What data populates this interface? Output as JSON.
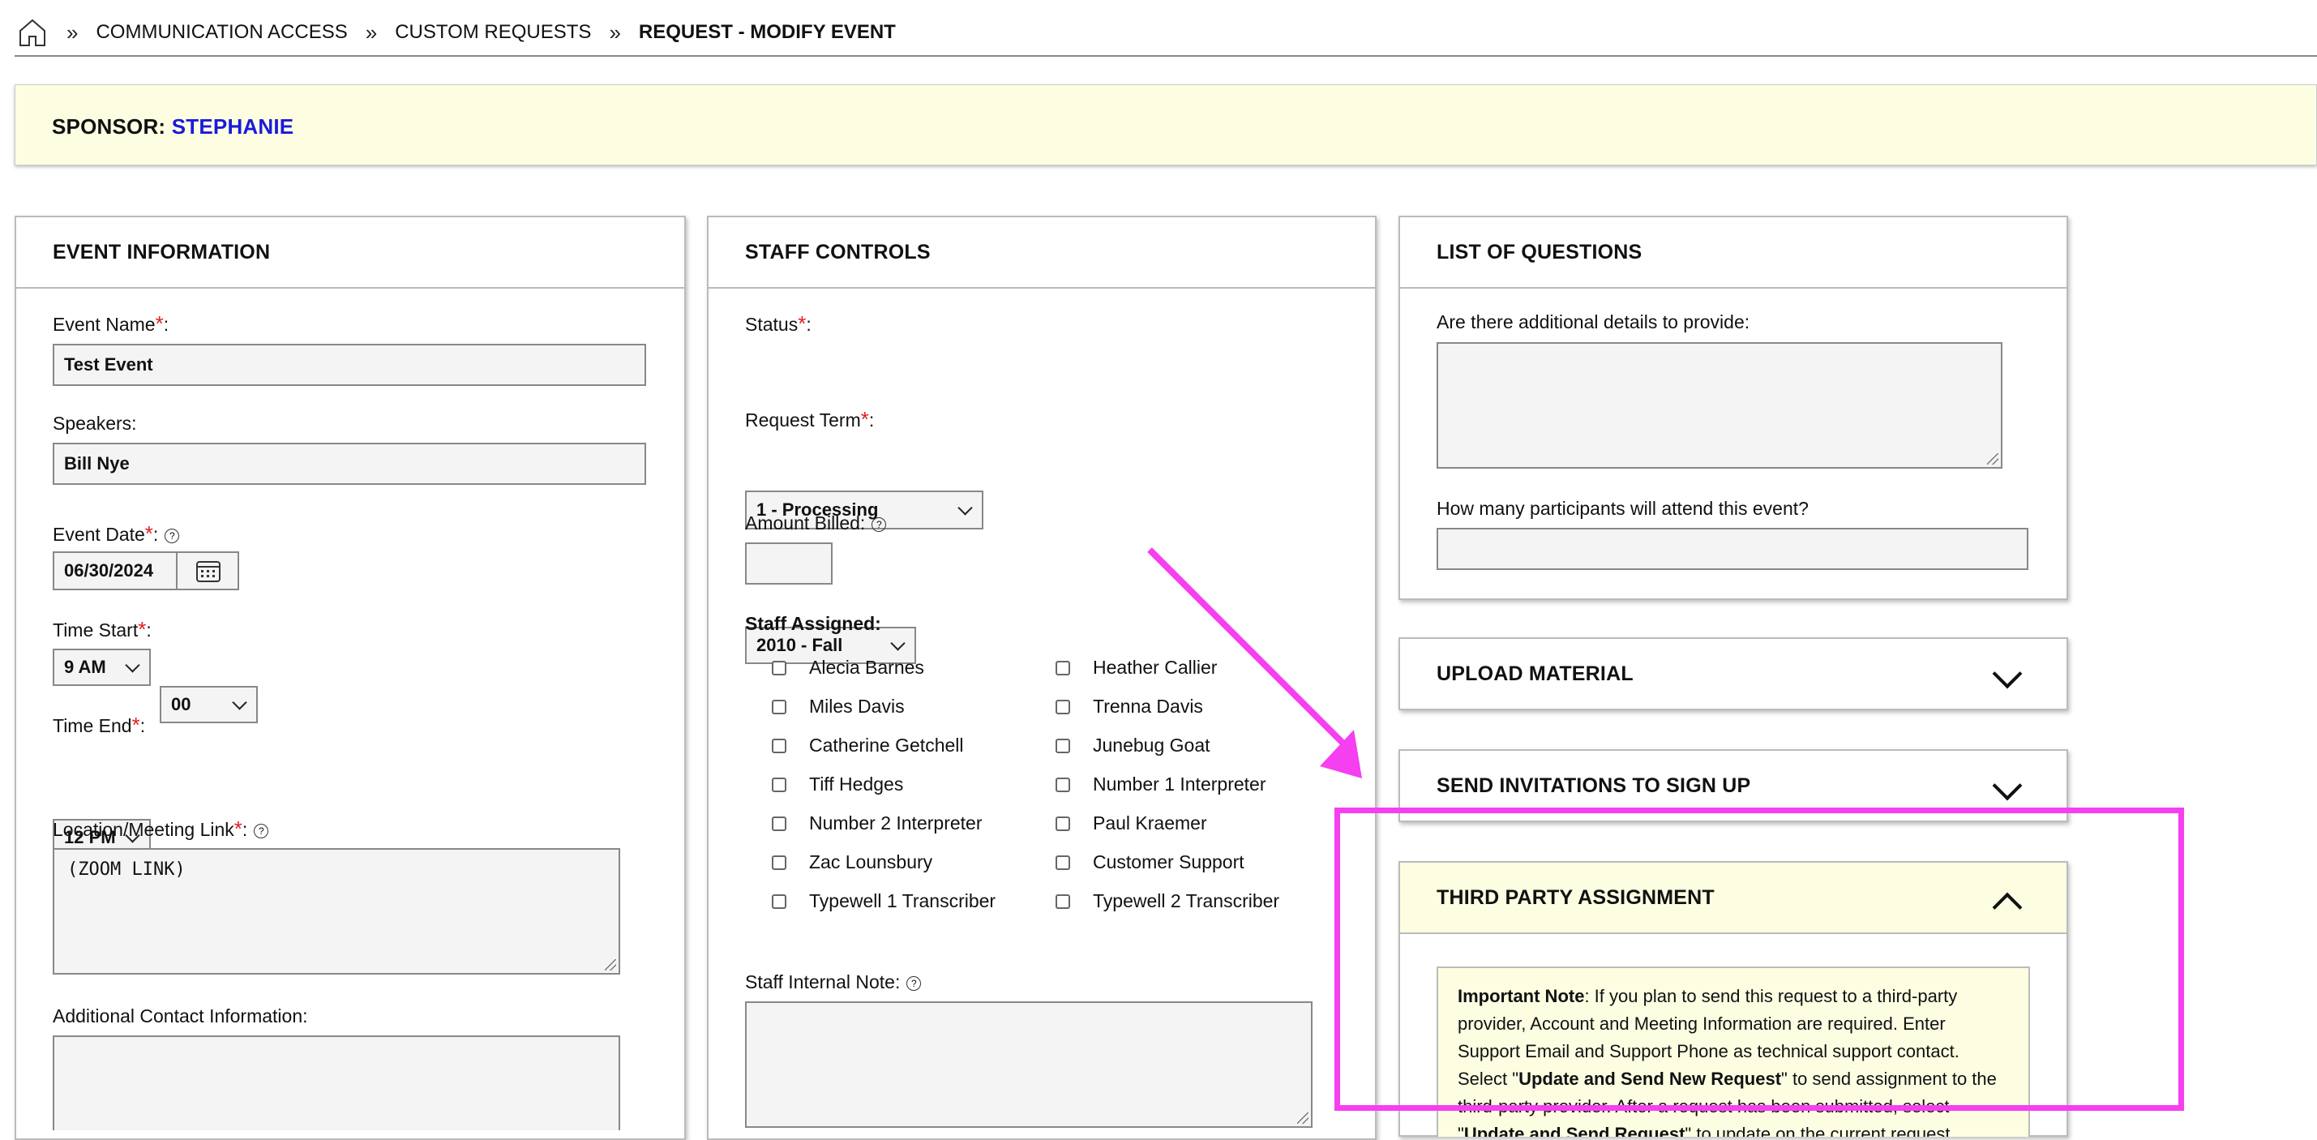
{
  "breadcrumb": {
    "items": [
      "COMMUNICATION ACCESS",
      "CUSTOM REQUESTS"
    ],
    "current": "REQUEST - MODIFY EVENT",
    "separator": "»"
  },
  "sponsor": {
    "label": "SPONSOR:",
    "name": "STEPHANIE"
  },
  "event_info": {
    "title": "EVENT INFORMATION",
    "event_name_label": "Event Name",
    "event_name_value": "Test Event",
    "speakers_label": "Speakers:",
    "speakers_value": "Bill Nye",
    "event_date_label": "Event Date",
    "event_date_value": "06/30/2024",
    "time_start_label": "Time Start",
    "time_start_hour": "9 AM",
    "time_start_min": "00",
    "time_end_label": "Time End",
    "time_end_hour": "12 PM",
    "time_end_min": "00",
    "location_label": "Location/Meeting Link",
    "location_value": "(ZOOM LINK)",
    "additional_contact_label": "Additional Contact Information:"
  },
  "staff_controls": {
    "title": "STAFF CONTROLS",
    "status_label": "Status",
    "status_value": "1 - Processing",
    "term_label": "Request Term",
    "term_value": "2010 - Fall",
    "amount_label": "Amount Billed:",
    "staff_assigned_label": "Staff Assigned:",
    "staff_col1": [
      "Alecia Barnes",
      "Miles Davis",
      "Catherine Getchell",
      "Tiff Hedges",
      "Number 2 Interpreter",
      "Zac Lounsbury",
      "Typewell 1 Transcriber"
    ],
    "staff_col2": [
      "Heather Callier",
      "Trenna Davis",
      "Junebug Goat",
      "Number 1 Interpreter",
      "Paul Kraemer",
      "Customer Support",
      "Typewell 2 Transcriber"
    ],
    "internal_note_label": "Staff Internal Note:"
  },
  "questions": {
    "title": "LIST OF QUESTIONS",
    "q1": "Are there additional details to provide:",
    "q2": "How many participants will attend this event?"
  },
  "upload": {
    "title": "UPLOAD MATERIAL"
  },
  "invitations": {
    "title": "SEND INVITATIONS TO SIGN UP"
  },
  "third_party": {
    "title": "THIRD PARTY ASSIGNMENT",
    "note_bold": "Important Note",
    "note_text_1": ": If you plan to send this request to a third-party provider, Account and Meeting Information are required. Enter Support Email and Support Phone as technical support contact. Select \"",
    "note_bold_2": "Update and Send New Request",
    "note_text_2": "\" to send assignment to the third-party provider. After a request has been submitted, select \"",
    "note_bold_3": "Update and Send Request",
    "note_text_3": "\" to update on the current request."
  },
  "colors": {
    "highlight": "#f53ff0",
    "sponsor_bg": "#fdfde2",
    "sponsor_name": "#1a1adb",
    "required": "#e02020"
  }
}
